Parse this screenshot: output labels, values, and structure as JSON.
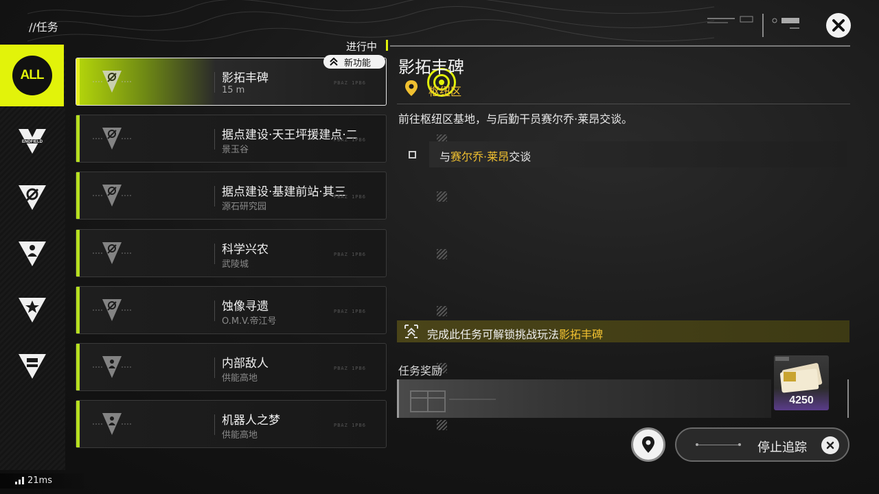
{
  "header": {
    "title": "//任务",
    "close_icon": "close-icon"
  },
  "rail": {
    "items": [
      {
        "label": "ALL",
        "icon": "all-filter-icon",
        "active": true
      },
      {
        "label": "ENDFIELD",
        "icon": "endfield-logo-icon"
      },
      {
        "label": "",
        "icon": "faction-icon"
      },
      {
        "label": "",
        "icon": "person-icon"
      },
      {
        "label": "",
        "icon": "star-icon"
      },
      {
        "label": "",
        "icon": "bag-icon"
      }
    ]
  },
  "list": {
    "in_progress_label": "进行中",
    "new_feature_label": "新功能",
    "stamp_text": "PBAZ 1PB6",
    "quests": [
      {
        "title": "影拓丰碑",
        "sub": "15 m",
        "active": true
      },
      {
        "title": "据点建设·天王坪援建点·二",
        "sub": "景玉谷"
      },
      {
        "title": "据点建设·基建前站·其三",
        "sub": "源石研究园"
      },
      {
        "title": "科学兴农",
        "sub": "武陵城"
      },
      {
        "title": "蚀像寻遗",
        "sub": "O.M.V.帝江号"
      },
      {
        "title": "内部敌人",
        "sub": "供能高地"
      },
      {
        "title": "机器人之梦",
        "sub": "供能高地"
      }
    ]
  },
  "detail": {
    "title": "影拓丰碑",
    "location": "枢纽区",
    "description": "前往枢纽区基地，与后勤干员赛尔乔·莱昂交谈。",
    "objective": {
      "prefix": "与",
      "name": "赛尔乔·莱昂",
      "suffix": "交谈"
    },
    "unlock": {
      "text": "完成此任务可解锁挑战玩法",
      "highlight": "影拓丰碑"
    },
    "reward_label": "任务奖励",
    "reward_qty": "4250"
  },
  "footer": {
    "stop_tracking_label": "停止追踪",
    "ping": "21ms"
  },
  "colors": {
    "accent": "#e2f30a",
    "gold": "#f0c030",
    "active_green": "#b7e020"
  }
}
